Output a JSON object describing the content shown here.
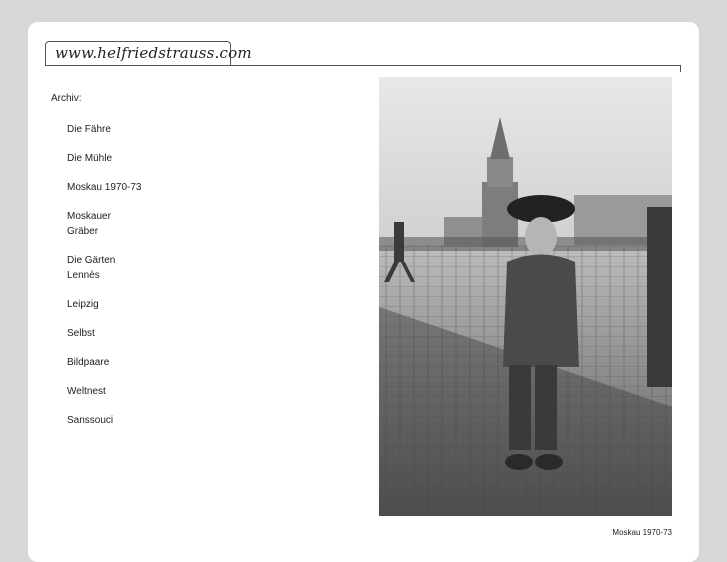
{
  "site": {
    "title": "www.helfriedstrauss.com"
  },
  "sidebar": {
    "heading": "Archiv:",
    "items": [
      {
        "label": "Die Fähre"
      },
      {
        "label": "Die Mühle"
      },
      {
        "label": "Moskau 1970-73"
      },
      {
        "label": "Moskauer\nGräber"
      },
      {
        "label": "Die Gärten\nLennès"
      },
      {
        "label": "Leipzig"
      },
      {
        "label": "Selbst"
      },
      {
        "label": "Bildpaare"
      },
      {
        "label": "Weltnest"
      },
      {
        "label": "Sanssouci"
      }
    ]
  },
  "photo": {
    "caption": "Moskau 1970-73"
  }
}
